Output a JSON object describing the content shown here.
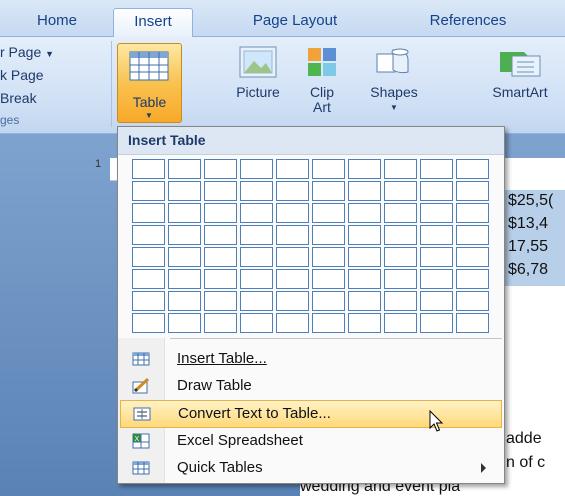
{
  "tabs": [
    {
      "label": "Home"
    },
    {
      "label": "Insert"
    },
    {
      "label": "Page Layout"
    },
    {
      "label": "References"
    }
  ],
  "pages_group": {
    "items": [
      "r Page",
      "k Page",
      "Break"
    ],
    "label": "ges"
  },
  "ribbon": {
    "table_label": "Table",
    "picture_label": "Picture",
    "clip_label_1": "Clip",
    "clip_label_2": "Art",
    "shapes_label": "Shapes",
    "smartart_label": "SmartArt"
  },
  "ruler": {
    "marker": "1"
  },
  "document": {
    "numbers": [
      "$25,5(",
      "$13,4",
      "17,55",
      "$6,78"
    ],
    "line1": "adde",
    "line2": "n of c",
    "line3": "wedding and event pla"
  },
  "dropdown": {
    "header": "Insert Table",
    "grid_cols": 10,
    "grid_rows": 8,
    "items": [
      {
        "label": "Insert Table...",
        "icon": "insert-table-icon"
      },
      {
        "label": "Draw Table",
        "icon": "draw-table-icon"
      },
      {
        "label": "Convert Text to Table...",
        "icon": "convert-text-icon",
        "highlighted": true
      },
      {
        "label": "Excel Spreadsheet",
        "icon": "excel-icon"
      },
      {
        "label": "Quick Tables",
        "icon": "quick-tables-icon",
        "submenu": true
      }
    ]
  },
  "colors": {
    "accent": "#f9c250",
    "tab_text": "#15428b",
    "grid_border": "#4f7fb8"
  }
}
